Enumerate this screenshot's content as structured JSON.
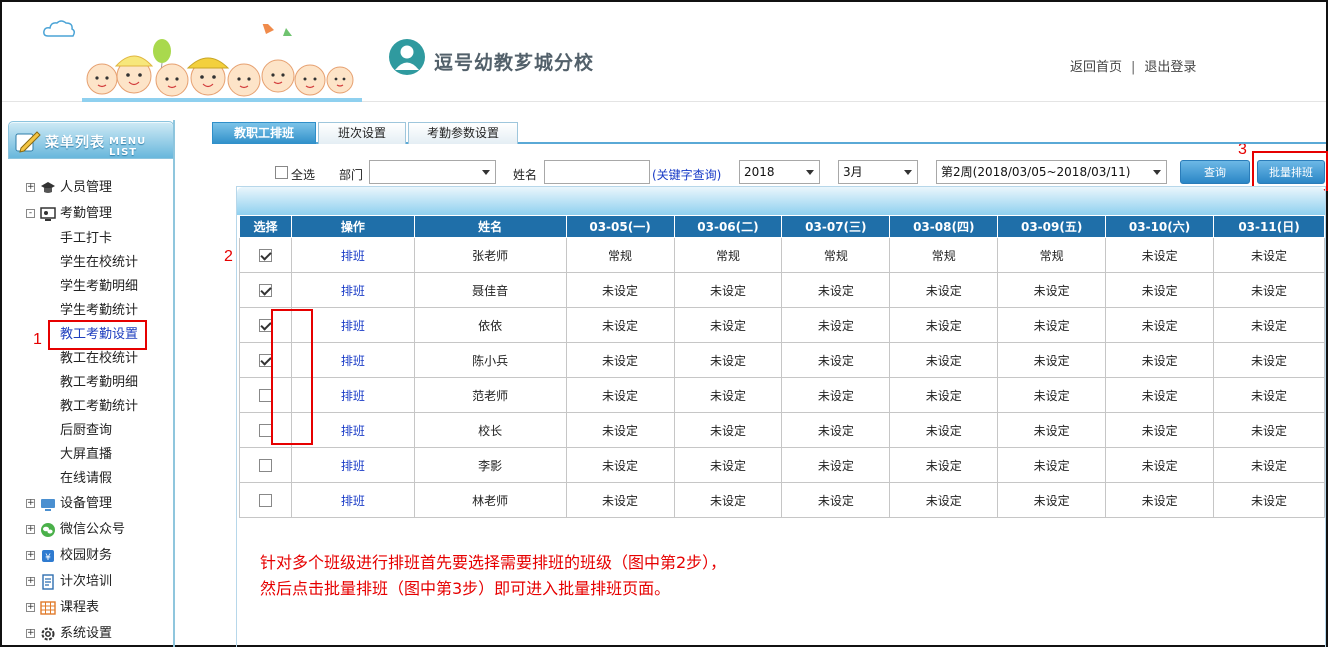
{
  "header": {
    "school_name": "逗号幼教芗城分校",
    "link_home": "返回首页",
    "separator": "|",
    "link_logout": "退出登录"
  },
  "sidebar": {
    "menu_title": "菜单列表",
    "menu_title_en": "MENU LIST",
    "items": [
      {
        "label": "人员管理",
        "expander": "+",
        "icon": "graduate-cap-icon"
      },
      {
        "label": "考勤管理",
        "expander": "-",
        "icon": "attendance-screen-icon"
      },
      {
        "label": "设备管理",
        "expander": "+",
        "icon": "device-icon"
      },
      {
        "label": "微信公众号",
        "expander": "+",
        "icon": "wechat-icon"
      },
      {
        "label": "校园财务",
        "expander": "+",
        "icon": "finance-icon"
      },
      {
        "label": "计次培训",
        "expander": "+",
        "icon": "training-icon"
      },
      {
        "label": "课程表",
        "expander": "+",
        "icon": "calendar-grid-icon"
      },
      {
        "label": "系统设置",
        "expander": "+",
        "icon": "gear-icon"
      }
    ],
    "sub_items": [
      "手工打卡",
      "学生在校统计",
      "学生考勤明细",
      "学生考勤统计",
      "教工考勤设置",
      "教工在校统计",
      "教工考勤明细",
      "教工考勤统计",
      "后厨查询",
      "大屏直播",
      "在线请假"
    ],
    "active_sub": "教工考勤设置"
  },
  "tabs": [
    {
      "label": "教职工排班",
      "active": true
    },
    {
      "label": "班次设置",
      "active": false
    },
    {
      "label": "考勤参数设置",
      "active": false
    }
  ],
  "filter": {
    "select_all_label": "全选",
    "dept_label": "部门",
    "dept_value": "",
    "name_label": "姓名",
    "name_value": "",
    "keyword_hint": "(关键字查询)",
    "year": "2018",
    "month": "3月",
    "week": "第2周(2018/03/05~2018/03/11)",
    "query_button": "查询",
    "batch_button": "批量排班"
  },
  "table": {
    "columns": [
      "选择",
      "操作",
      "姓名",
      "03-05(一)",
      "03-06(二)",
      "03-07(三)",
      "03-08(四)",
      "03-09(五)",
      "03-10(六)",
      "03-11(日)"
    ],
    "action_label": "排班",
    "rows": [
      {
        "checked": true,
        "name": "张老师",
        "days": [
          "常规",
          "常规",
          "常规",
          "常规",
          "常规",
          "未设定",
          "未设定"
        ]
      },
      {
        "checked": true,
        "name": "聂佳音",
        "days": [
          "未设定",
          "未设定",
          "未设定",
          "未设定",
          "未设定",
          "未设定",
          "未设定"
        ]
      },
      {
        "checked": true,
        "name": "依依",
        "days": [
          "未设定",
          "未设定",
          "未设定",
          "未设定",
          "未设定",
          "未设定",
          "未设定"
        ]
      },
      {
        "checked": true,
        "name": "陈小兵",
        "days": [
          "未设定",
          "未设定",
          "未设定",
          "未设定",
          "未设定",
          "未设定",
          "未设定"
        ]
      },
      {
        "checked": false,
        "name": "范老师",
        "days": [
          "未设定",
          "未设定",
          "未设定",
          "未设定",
          "未设定",
          "未设定",
          "未设定"
        ]
      },
      {
        "checked": false,
        "name": "校长",
        "days": [
          "未设定",
          "未设定",
          "未设定",
          "未设定",
          "未设定",
          "未设定",
          "未设定"
        ]
      },
      {
        "checked": false,
        "name": "李影",
        "days": [
          "未设定",
          "未设定",
          "未设定",
          "未设定",
          "未设定",
          "未设定",
          "未设定"
        ]
      },
      {
        "checked": false,
        "name": "林老师",
        "days": [
          "未设定",
          "未设定",
          "未设定",
          "未设定",
          "未设定",
          "未设定",
          "未设定"
        ]
      }
    ]
  },
  "annotations": {
    "step1": "1",
    "step2": "2",
    "step3": "3",
    "note_line1": "针对多个班级进行排班首先要选择需要排班的班级（图中第2步），",
    "note_line2": "然后点击批量排班（图中第3步）即可进入批量排班页面。"
  },
  "colors": {
    "accent_blue": "#1f6fa9",
    "annotation_red": "#e60000",
    "link_blue": "#1a3cc7"
  }
}
